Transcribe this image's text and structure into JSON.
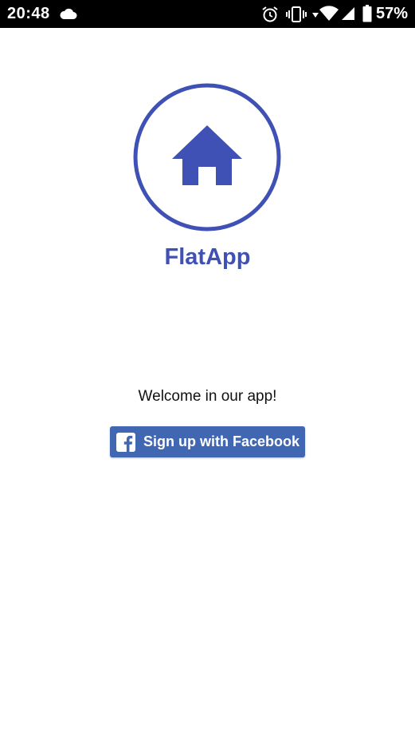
{
  "status_bar": {
    "time": "20:48",
    "battery_percent": "57%",
    "icons": [
      "cloud-icon",
      "alarm-icon",
      "vibrate-icon",
      "data-arrow-icon",
      "wifi-icon",
      "cellular-signal-icon",
      "battery-icon"
    ]
  },
  "app": {
    "title": "FlatApp",
    "logo_icon": "home-icon",
    "accent_color": "#3f51b5"
  },
  "main": {
    "welcome": "Welcome in our app!",
    "facebook_button": {
      "label": "Sign up with Facebook",
      "icon": "facebook-icon",
      "color": "#4267b2"
    }
  }
}
